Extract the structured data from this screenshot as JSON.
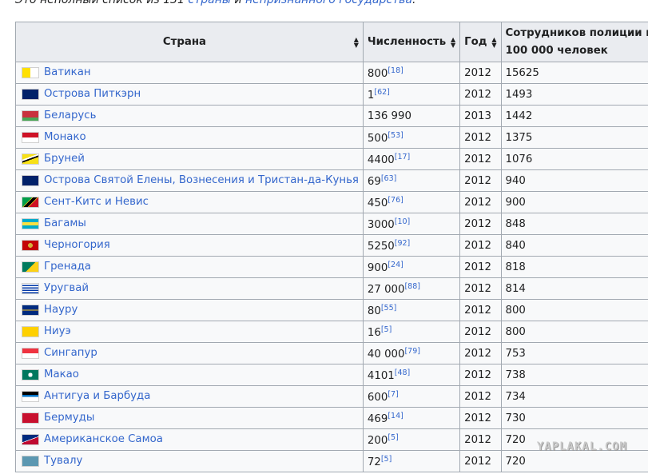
{
  "caption": {
    "prefix": "Это неполный список из 131 ",
    "link1": "страны",
    "middle": " и ",
    "link2": "непризнанного государства",
    "suffix": "."
  },
  "table": {
    "headers": {
      "country": "Страна",
      "population": "Численность",
      "year": "Год",
      "police_line1": "Сотрудников полиции на",
      "police_line2": "100 000 человек"
    },
    "rows": [
      {
        "flag": "flag-vatican",
        "country": "Ватикан",
        "pop": "800",
        "ref": "[18]",
        "year": "2012",
        "police": "15625"
      },
      {
        "flag": "flag-pitcairn",
        "country": "Острова Питкэрн",
        "pop": "1",
        "ref": "[62]",
        "year": "2012",
        "police": "1493"
      },
      {
        "flag": "flag-belarus",
        "country": "Беларусь",
        "pop": "136 990",
        "ref": "",
        "year": "2013",
        "police": "1442"
      },
      {
        "flag": "flag-monaco",
        "country": "Монако",
        "pop": "500",
        "ref": "[53]",
        "year": "2012",
        "police": "1375"
      },
      {
        "flag": "flag-brunei",
        "country": "Бруней",
        "pop": "4400",
        "ref": "[17]",
        "year": "2012",
        "police": "1076"
      },
      {
        "flag": "flag-st-helena",
        "country": "Острова Святой Елены, Вознесения и Тристан-да-Кунья",
        "pop": "69",
        "ref": "[63]",
        "year": "2012",
        "police": "940"
      },
      {
        "flag": "flag-st-kitts",
        "country": "Сент-Китс и Невис",
        "pop": "450",
        "ref": "[76]",
        "year": "2012",
        "police": "900"
      },
      {
        "flag": "flag-bahamas",
        "country": "Багамы",
        "pop": "3000",
        "ref": "[10]",
        "year": "2012",
        "police": "848"
      },
      {
        "flag": "flag-montenegro",
        "country": "Черногория",
        "pop": "5250",
        "ref": "[92]",
        "year": "2012",
        "police": "840"
      },
      {
        "flag": "flag-grenada",
        "country": "Гренада",
        "pop": "900",
        "ref": "[24]",
        "year": "2012",
        "police": "818"
      },
      {
        "flag": "flag-uruguay",
        "country": "Уругвай",
        "pop": "27 000",
        "ref": "[88]",
        "year": "2012",
        "police": "814"
      },
      {
        "flag": "flag-nauru",
        "country": "Науру",
        "pop": "80",
        "ref": "[55]",
        "year": "2012",
        "police": "800"
      },
      {
        "flag": "flag-niue",
        "country": "Ниуэ",
        "pop": "16",
        "ref": "[5]",
        "year": "2012",
        "police": "800"
      },
      {
        "flag": "flag-singapore",
        "country": "Сингапур",
        "pop": "40 000",
        "ref": "[79]",
        "year": "2012",
        "police": "753"
      },
      {
        "flag": "flag-macau",
        "country": "Макао",
        "pop": "4101",
        "ref": "[48]",
        "year": "2012",
        "police": "738"
      },
      {
        "flag": "flag-antigua",
        "country": "Антигуа и Барбуда",
        "pop": "600",
        "ref": "[7]",
        "year": "2012",
        "police": "734"
      },
      {
        "flag": "flag-bermuda",
        "country": "Бермуды",
        "pop": "469",
        "ref": "[14]",
        "year": "2012",
        "police": "730"
      },
      {
        "flag": "flag-american-samoa",
        "country": "Американское Самоа",
        "pop": "200",
        "ref": "[5]",
        "year": "2012",
        "police": "720"
      },
      {
        "flag": "flag-tuvalu",
        "country": "Тувалу",
        "pop": "72",
        "ref": "[5]",
        "year": "2012",
        "police": "720"
      }
    ]
  },
  "watermark": "YAPLAKAL.COM"
}
